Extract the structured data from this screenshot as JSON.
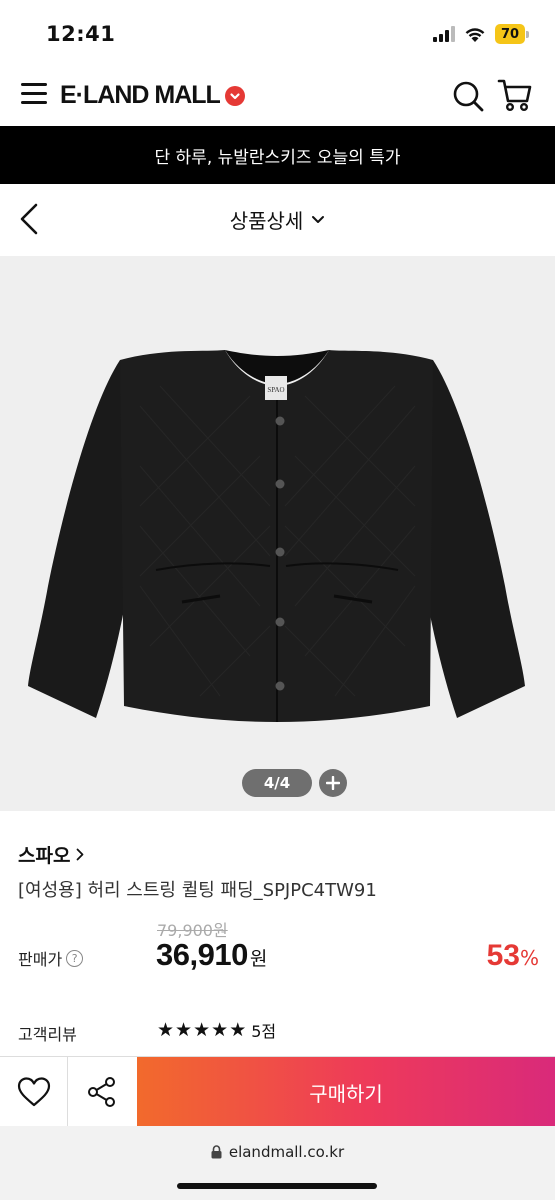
{
  "status_bar": {
    "time": "12:41",
    "battery": "70"
  },
  "header": {
    "logo": "E·LAND MALL"
  },
  "promo": {
    "text": "단 하루, 뉴발란스키즈 오늘의 특가"
  },
  "subnav": {
    "title": "상품상세"
  },
  "gallery": {
    "page_indicator": "4/4",
    "jacket_label": "SPAO"
  },
  "product": {
    "brand": "스파오",
    "name": "[여성용] 허리 스트링 퀼팅 패딩_SPJPC4TW91",
    "original_price": "79,900원",
    "price_label": "판매가",
    "sale_price": "36,910",
    "sale_price_unit": "원",
    "discount": "53",
    "discount_unit": "%",
    "review_label": "고객리뷰",
    "review_stars": 5,
    "review_score": "5점"
  },
  "bottom_bar": {
    "buy_label": "구매하기"
  },
  "browser": {
    "url": "elandmall.co.kr"
  },
  "colors": {
    "accent": "#e53935",
    "buy_gradient_start": "#f26a2c",
    "buy_gradient_end": "#d92a7a"
  }
}
